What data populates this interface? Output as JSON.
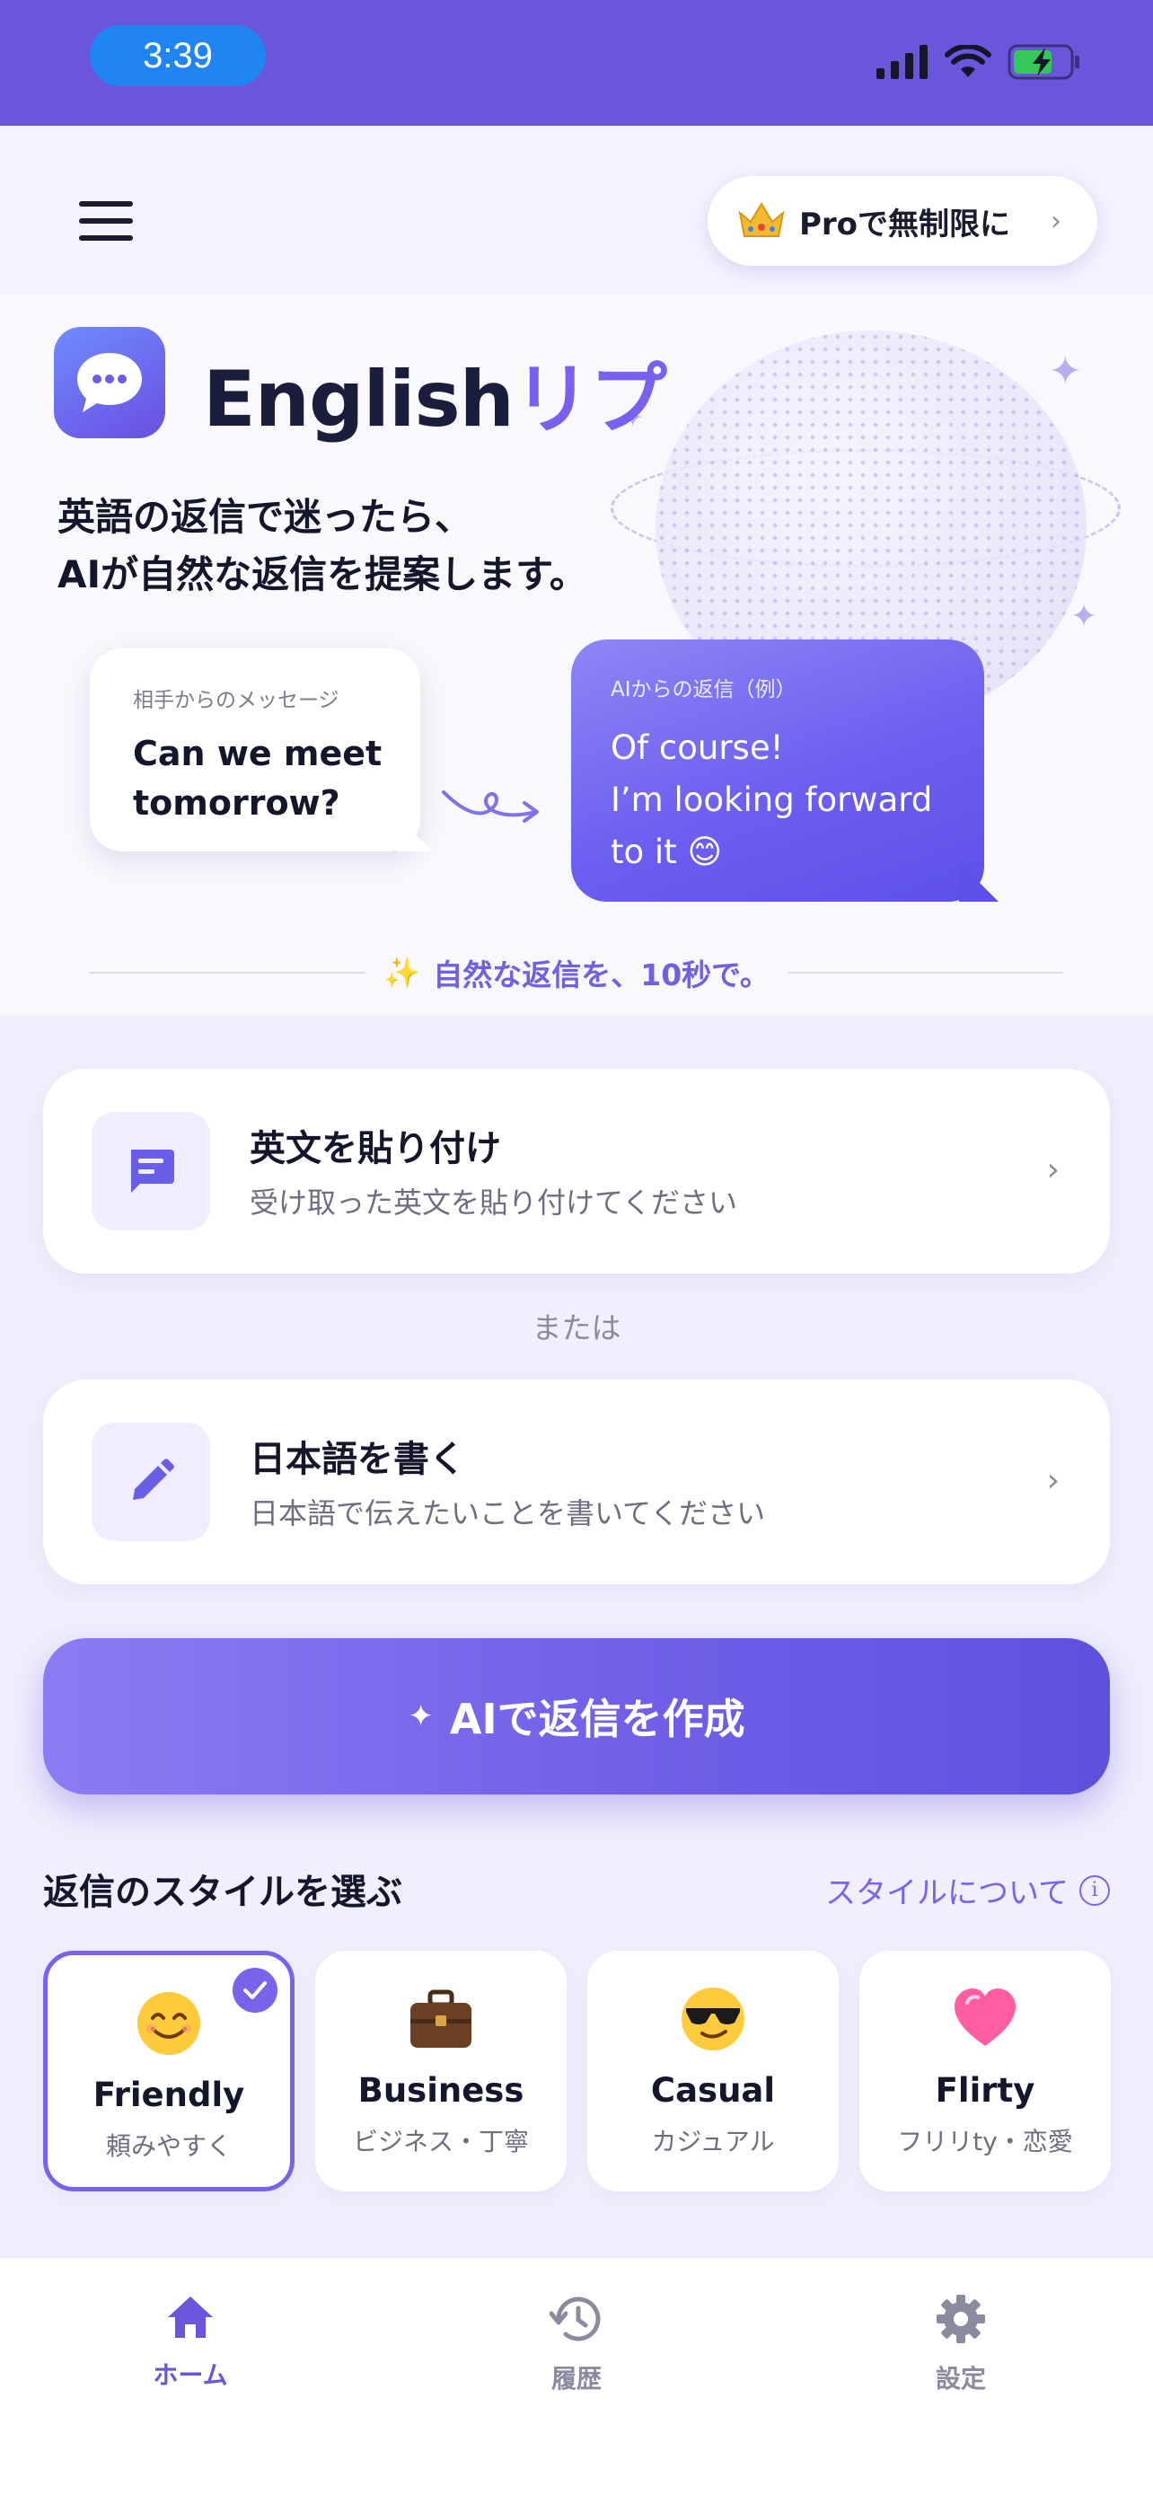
{
  "status_bar": {
    "time": "3:39"
  },
  "header": {
    "pro_button_label": "Proで無制限に",
    "pro_icon": "crown-icon"
  },
  "hero": {
    "app_name_part1": "English",
    "app_name_part2": "リプ",
    "tagline_line1": "英語の返信で迷ったら、",
    "tagline_line2": "AIが自然な返信を提案します。",
    "incoming_label": "相手からのメッセージ",
    "incoming_line1": "Can we meet",
    "incoming_line2": "tomorrow?",
    "reply_label": "AIからの返信（例）",
    "reply_line1": "Of course!",
    "reply_line2": "I’m looking forward",
    "reply_line3": "to it 😊",
    "tagline_small": "自然な返信を、10秒で。"
  },
  "inputs": {
    "paste_title": "英文を貼り付け",
    "paste_subtitle": "受け取った英文を貼り付けてください",
    "or_label": "または",
    "write_title": "日本語を書く",
    "write_subtitle": "日本語で伝えたいことを書いてください"
  },
  "cta": {
    "label": "AIで返信を作成"
  },
  "styles": {
    "heading": "返信のスタイルを選ぶ",
    "about_link": "スタイルについて",
    "selected": "Friendly",
    "options": [
      {
        "name": "Friendly",
        "desc": "頼みやすく",
        "emoji": "😊",
        "icon": "smiling-face-icon"
      },
      {
        "name": "Business",
        "desc": "ビジネス・丁寧",
        "emoji": "💼",
        "icon": "briefcase-icon"
      },
      {
        "name": "Casual",
        "desc": "カジュアル",
        "emoji": "😎",
        "icon": "sunglasses-face-icon"
      },
      {
        "name": "Flirty",
        "desc": "フリリty・恋愛",
        "emoji": "💗",
        "icon": "heart-icon"
      }
    ]
  },
  "tabbar": {
    "active": "ホーム",
    "items": [
      {
        "label": "ホーム",
        "icon": "home-icon"
      },
      {
        "label": "履歴",
        "icon": "history-icon"
      },
      {
        "label": "設定",
        "icon": "gear-icon"
      }
    ]
  },
  "colors": {
    "accent": "#7a63ea",
    "status_bar": "#6a56da",
    "inactive": "#8a8b9e"
  }
}
